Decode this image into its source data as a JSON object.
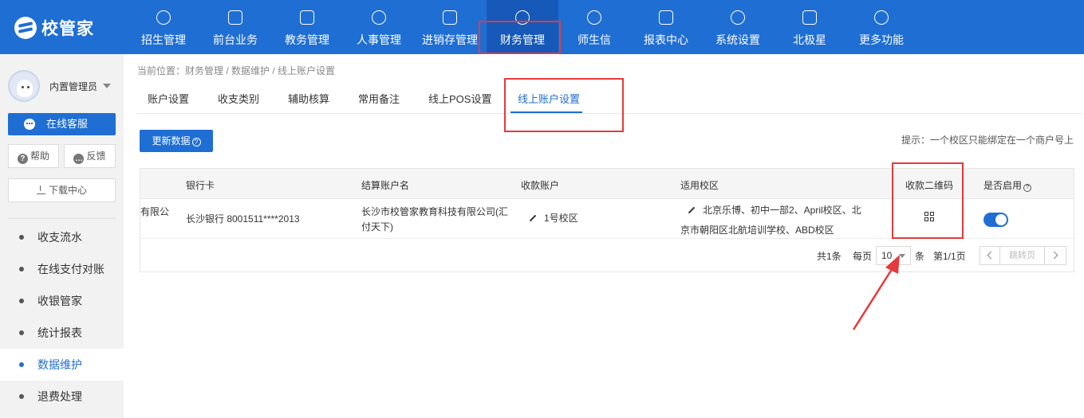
{
  "app": {
    "logo_text": "校管家"
  },
  "topnav": {
    "items": [
      {
        "label": "招生管理",
        "icon": "user-add-icon"
      },
      {
        "label": "前台业务",
        "icon": "monitor-icon"
      },
      {
        "label": "教务管理",
        "icon": "book-icon"
      },
      {
        "label": "人事管理",
        "icon": "person-icon"
      },
      {
        "label": "进销存管理",
        "icon": "inventory-icon"
      },
      {
        "label": "财务管理",
        "icon": "finance-icon",
        "active": true
      },
      {
        "label": "师生信",
        "icon": "chat-icon"
      },
      {
        "label": "报表中心",
        "icon": "report-icon"
      },
      {
        "label": "系统设置",
        "icon": "settings-icon"
      },
      {
        "label": "北极星",
        "icon": "star-icon"
      },
      {
        "label": "更多功能",
        "icon": "more-icon"
      }
    ]
  },
  "sidebar": {
    "username": "内置管理员",
    "customer_service": "在线客服",
    "help": "帮助",
    "feedback": "反馈",
    "download": "下载中心",
    "menu": [
      {
        "label": "收支流水"
      },
      {
        "label": "在线支付对账"
      },
      {
        "label": "收银管家"
      },
      {
        "label": "统计报表"
      },
      {
        "label": "数据维护",
        "active": true
      },
      {
        "label": "退费处理"
      }
    ]
  },
  "breadcrumb": "当前位置：财务管理 / 数据维护 / 线上账户设置",
  "tabs": [
    {
      "label": "账户设置"
    },
    {
      "label": "收支类别"
    },
    {
      "label": "辅助核算"
    },
    {
      "label": "常用备注"
    },
    {
      "label": "线上POS设置"
    },
    {
      "label": "线上账户设置",
      "active": true
    }
  ],
  "toolbar": {
    "refresh_label": "更新数据",
    "help_mark": "?"
  },
  "hint": "提示：一个校区只能绑定在一个商户号上",
  "table": {
    "columns": [
      "银行卡",
      "结算账户名",
      "收款账户",
      "适用校区",
      "收款二维码",
      "是否启用"
    ],
    "enabled_help": "?",
    "rows": [
      {
        "partial_name": "有限公",
        "bank_card": "长沙银行 8001511****2013",
        "settlement_name_line1": "长沙市校管家教育科技有限公司(汇",
        "settlement_name_line2": "付天下)",
        "collect_account": "1号校区",
        "campus_line1": "北京乐博、初中一部2、April校区、北",
        "campus_line2": "京市朝阳区北航培训学校、ABD校区",
        "qr_icon": "qrcode-icon",
        "enabled": true
      }
    ]
  },
  "pagination": {
    "total": "共1条",
    "per_page_label": "每页",
    "per_page_value": "10",
    "unit": "条",
    "page_info": "第1/1页",
    "jump_label": "跳转页"
  },
  "colors": {
    "primary": "#1f6ed4",
    "highlight": "#e6393c"
  }
}
